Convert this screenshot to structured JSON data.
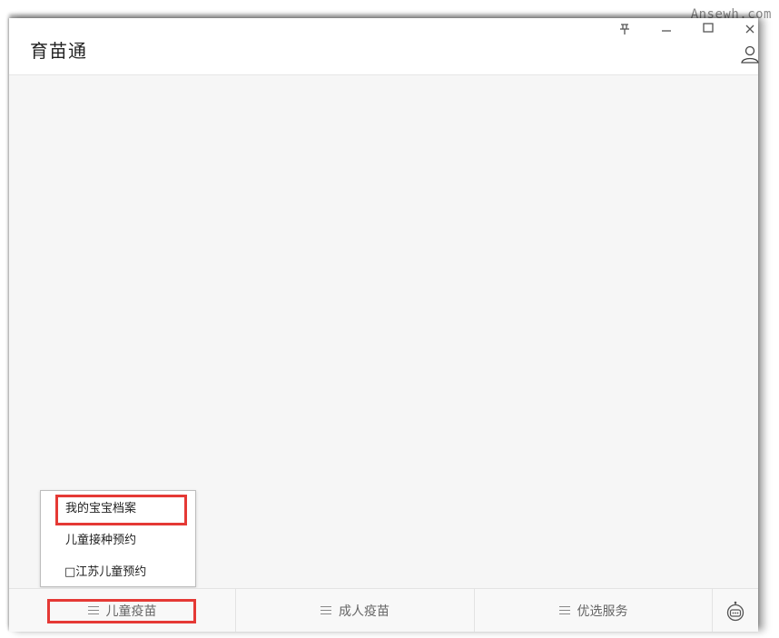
{
  "watermark": "Ansewh.com",
  "window": {
    "title": "育苗通",
    "controls": {
      "pin_icon": "pin-icon",
      "minimize_icon": "minimize-icon",
      "maximize_icon": "maximize-icon",
      "close_icon": "close-icon",
      "user_icon": "user-icon"
    }
  },
  "popup_menu": {
    "items": [
      {
        "label": "我的宝宝档案"
      },
      {
        "label": "儿童接种预约"
      },
      {
        "label": "□江苏儿童预约"
      }
    ]
  },
  "tabbar": {
    "tabs": [
      {
        "label": "儿童疫苗"
      },
      {
        "label": "成人疫苗"
      },
      {
        "label": "优选服务"
      }
    ],
    "bot_icon": "robot-icon"
  },
  "colors": {
    "highlight": "#e53935",
    "background": "#f6f6f6"
  }
}
